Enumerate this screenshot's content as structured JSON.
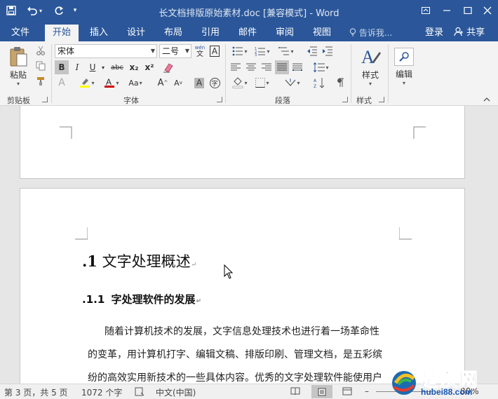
{
  "titlebar": {
    "title": "长文档排版原始素材.doc [兼容模式] - Word",
    "save_icon": "save-icon",
    "undo_icon": "undo-icon",
    "redo_icon": "redo-icon",
    "customize_icon": "customize-quick-access-icon",
    "ribbon_display_icon": "ribbon-display-options-icon",
    "minimize_icon": "minimize-icon",
    "maximize_icon": "maximize-icon",
    "close_icon": "close-icon"
  },
  "tabs": {
    "items": [
      "文件",
      "开始",
      "插入",
      "设计",
      "布局",
      "引用",
      "邮件",
      "审阅",
      "视图"
    ],
    "active": "开始",
    "tell_me": "告诉我...",
    "login": "登录",
    "share": "共享"
  },
  "ribbon": {
    "clipboard": {
      "label": "剪贴板",
      "paste": "粘贴"
    },
    "font": {
      "label": "字体",
      "font_name": "宋体",
      "font_size": "二号",
      "bold": "B",
      "italic": "I",
      "underline": "U",
      "strike": "abc",
      "subscript": "x₂",
      "superscript": "x²",
      "grow": "A",
      "shrink": "A",
      "char_shading": "A",
      "phonetic": "wén",
      "enclose": "字"
    },
    "paragraph": {
      "label": "段落"
    },
    "styles": {
      "label": "样式",
      "button": "样式"
    },
    "editing": {
      "button": "编辑"
    },
    "colors": {
      "highlight": "#ffff00",
      "font_color": "#d00000",
      "accent": "#2b579a"
    }
  },
  "document": {
    "heading1": {
      "num": ".1",
      "text": "文字处理概述"
    },
    "heading2": {
      "num": ".1.1",
      "text": "字处理软件的发展"
    },
    "paragraph_lines": [
      "随着计算机技术的发展，文字信息处理技术也进行着一场革命性",
      "的变革，用计算机打字、编辑文稿、排版印刷、管理文档，是五彩缤",
      "纷的高效实用新技术的一些具体内容。优秀的文字处理软件能使用户"
    ]
  },
  "status": {
    "page": "第 3 页，共 5 页",
    "words": "1072 个字",
    "language": "中文(中国)",
    "zoom": "80%"
  },
  "watermark": {
    "brand": "楚汉网",
    "domain": "hubei88.com"
  }
}
